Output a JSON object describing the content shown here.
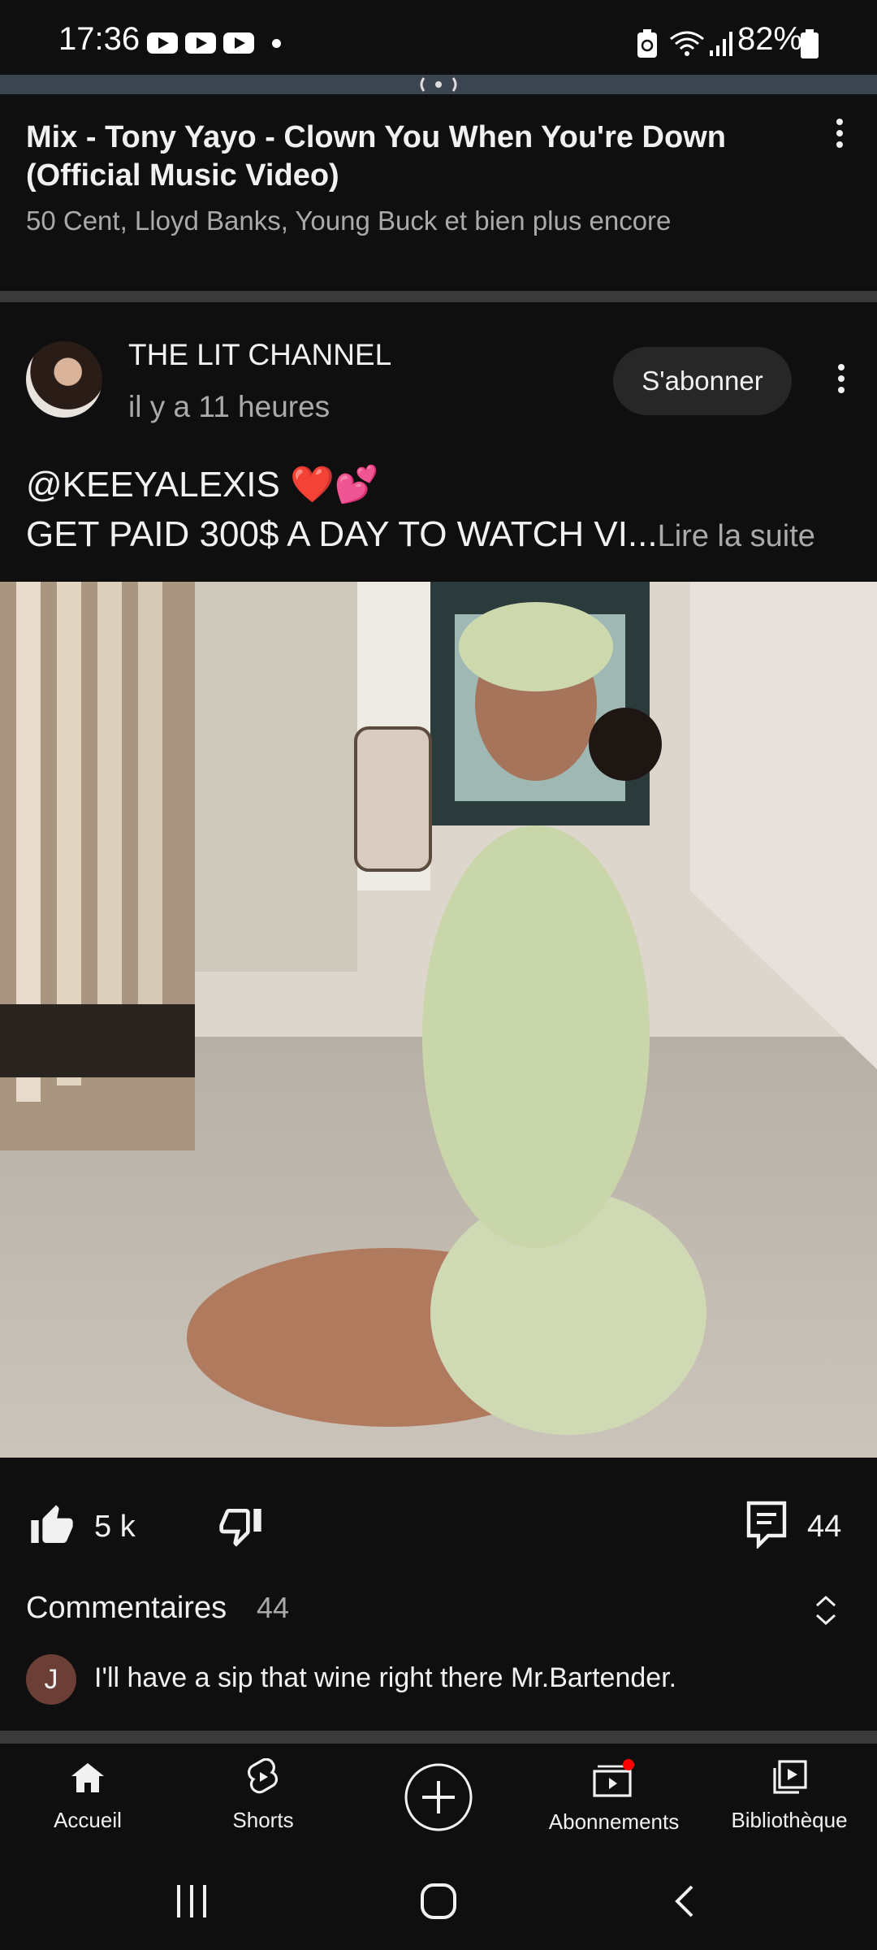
{
  "status_bar": {
    "time": "17:36",
    "battery": "82%",
    "icons": [
      "youtube-notification-icon",
      "youtube-notification-icon",
      "youtube-notification-icon",
      "battery-saver-icon",
      "wifi-icon",
      "signal-icon",
      "battery-icon"
    ]
  },
  "mix": {
    "title": "Mix - Tony Yayo - Clown You When You're Down (Official Music Video)",
    "subtitle": "50 Cent, Lloyd Banks, Young Buck et bien plus encore"
  },
  "post": {
    "channel": "THE LIT CHANNEL",
    "time": "il y a 11 heures",
    "subscribe": "S'abonner",
    "line1": "@KEEYALEXIS ❤️💕",
    "line2": "GET PAID 300$ A DAY TO WATCH VI...",
    "read_more": "Lire la suite",
    "likes": "5 k",
    "comments": "44"
  },
  "comments_section": {
    "label": "Commentaires",
    "count": "44",
    "top_comment": {
      "avatar_letter": "J",
      "text": "I'll have a sip that wine right there Mr.Bartender."
    }
  },
  "nav": {
    "home": "Accueil",
    "shorts": "Shorts",
    "subscriptions": "Abonnements",
    "library": "Bibliothèque"
  },
  "colors": {
    "background": "#0f0f0f",
    "text": "#f1f1f1",
    "secondary_text": "#aaaaaa",
    "subscribe_bg": "#272727",
    "notification_dot": "#ff0000"
  }
}
